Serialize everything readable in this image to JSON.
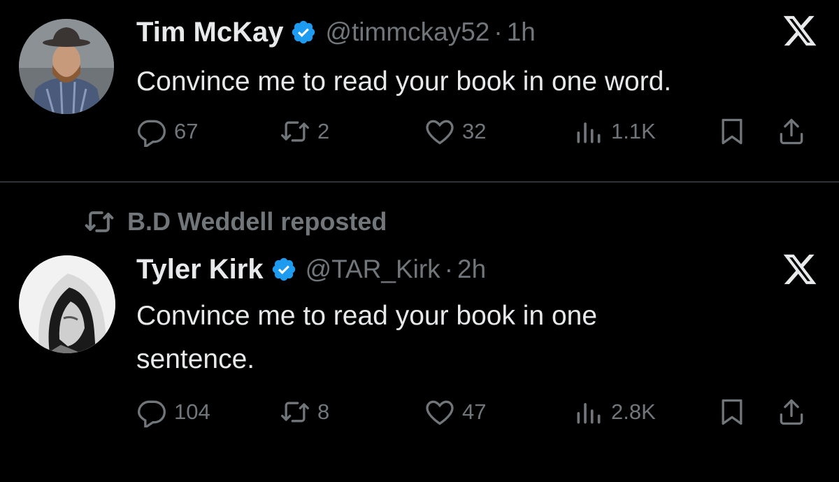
{
  "tweets": [
    {
      "name": "Tim McKay",
      "handle": "@timmckay52",
      "separator": "·",
      "time": "1h",
      "text": "Convince me to read your book in one word.",
      "stats": {
        "replies": "67",
        "reposts": "2",
        "likes": "32",
        "views": "1.1K"
      }
    },
    {
      "repost_label": "B.D Weddell reposted",
      "name": "Tyler Kirk",
      "handle": "@TAR_Kirk",
      "separator": "·",
      "time": "2h",
      "text": "Convince me to read your book in one sentence.",
      "stats": {
        "replies": "104",
        "reposts": "8",
        "likes": "47",
        "views": "2.8K"
      }
    }
  ],
  "colors": {
    "background": "#000000",
    "text": "#e7e9ea",
    "muted": "#71767b",
    "verified": "#1d9bf0",
    "divider": "#2f3336"
  },
  "icons": [
    "verified-badge-icon",
    "x-logo-icon",
    "reply-icon",
    "repost-icon",
    "like-icon",
    "views-icon",
    "bookmark-icon",
    "share-icon",
    "avatar"
  ]
}
